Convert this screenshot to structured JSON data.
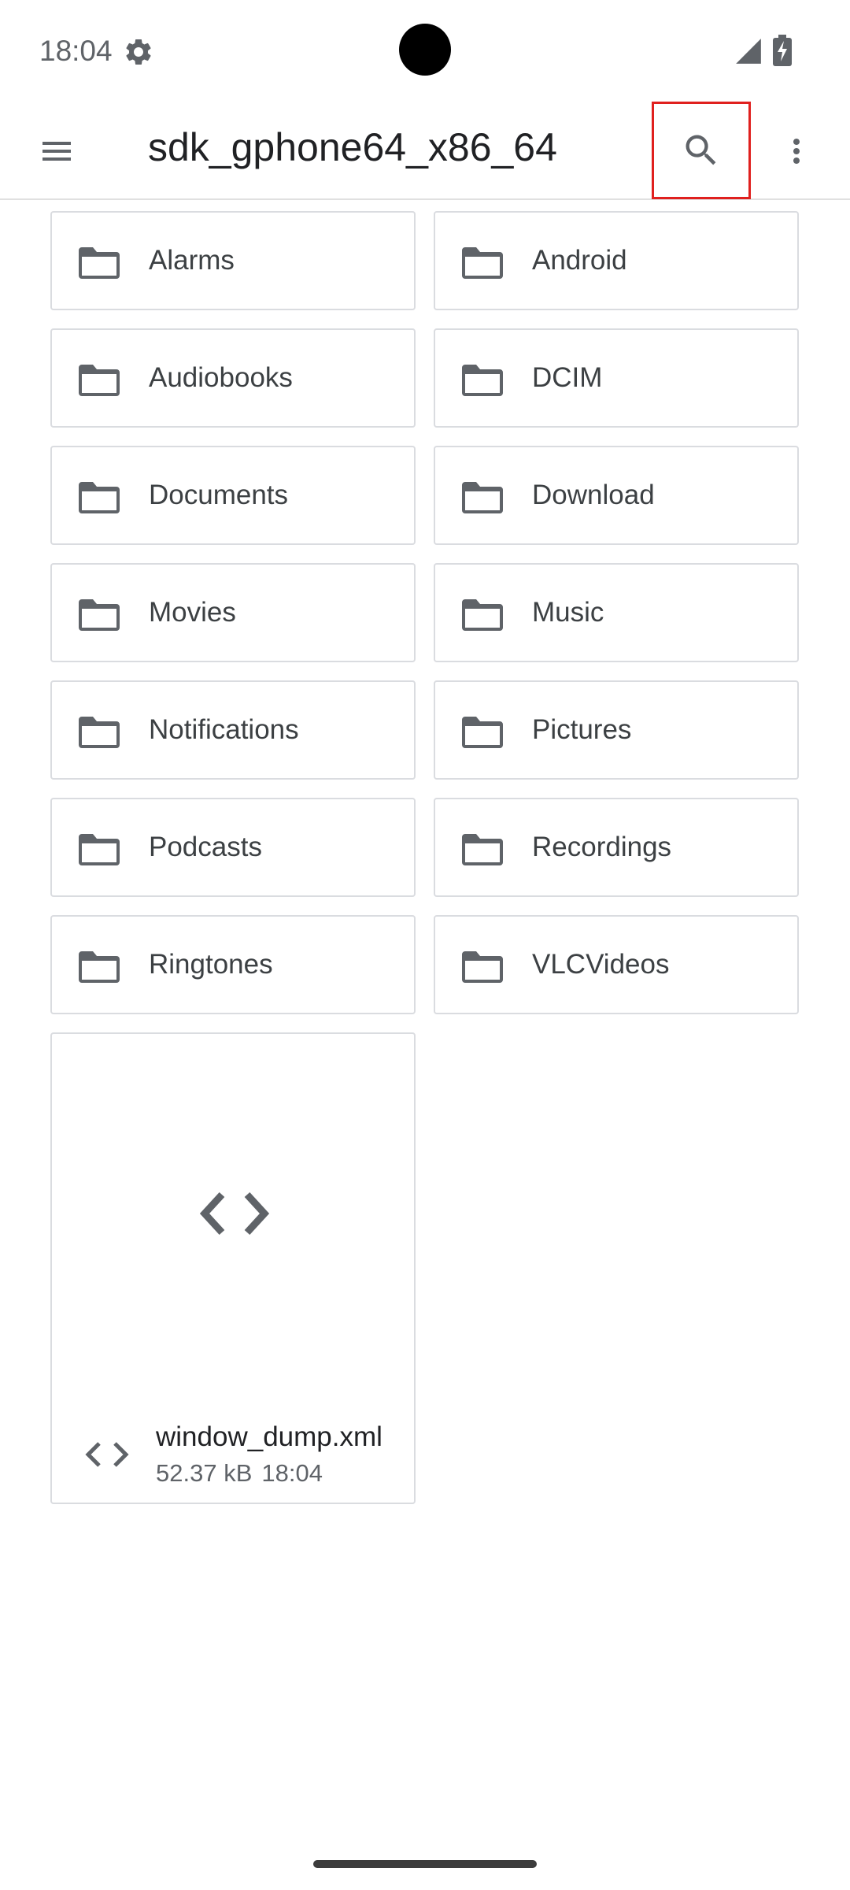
{
  "status_bar": {
    "time": "18:04",
    "icons": [
      "settings-icon",
      "signal-icon",
      "battery-charging-icon"
    ]
  },
  "app_bar": {
    "title": "sdk_gphone64_x86_64",
    "menu_icon": "menu-icon",
    "search_icon": "search-icon",
    "more_icon": "more-vert-icon"
  },
  "folders": [
    {
      "name": "Alarms"
    },
    {
      "name": "Android"
    },
    {
      "name": "Audiobooks"
    },
    {
      "name": "DCIM"
    },
    {
      "name": "Documents"
    },
    {
      "name": "Download"
    },
    {
      "name": "Movies"
    },
    {
      "name": "Music"
    },
    {
      "name": "Notifications"
    },
    {
      "name": "Pictures"
    },
    {
      "name": "Podcasts"
    },
    {
      "name": "Recordings"
    },
    {
      "name": "Ringtones"
    },
    {
      "name": "VLCVideos"
    }
  ],
  "files": [
    {
      "name": "window_dump.xml",
      "size": "52.37 kB",
      "time": "18:04",
      "icon": "code-icon"
    }
  ],
  "colors": {
    "highlight": "#e0201e",
    "icon": "#5f6368",
    "border": "#dadce0"
  }
}
